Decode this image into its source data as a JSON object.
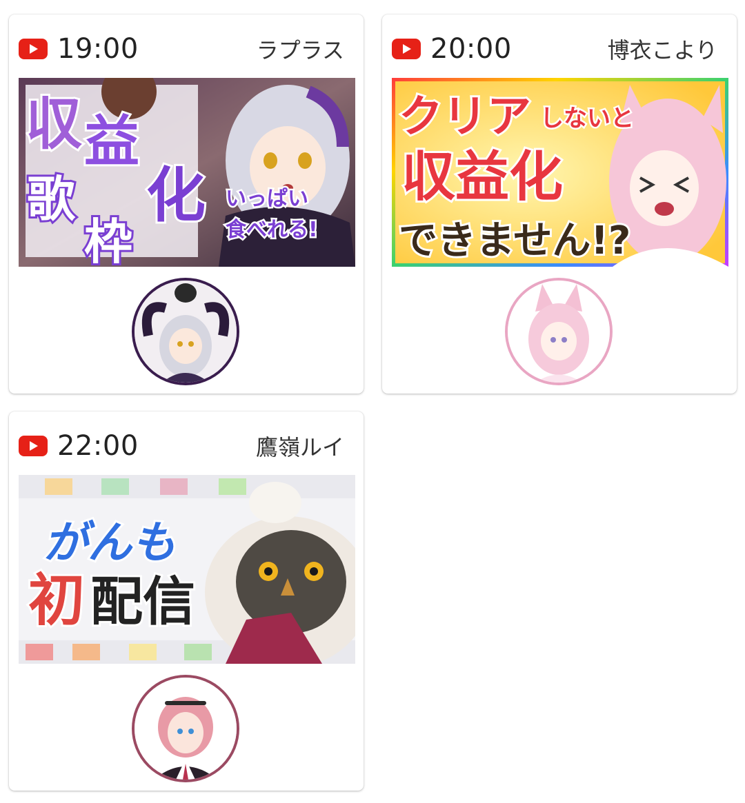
{
  "cards": [
    {
      "time": "19:00",
      "streamer": "ラプラス",
      "thumbnail_lines": [
        "収",
        "益",
        "化",
        "歌",
        "枠",
        "いっぱい",
        "食べれる!"
      ],
      "accent_color": "#3a1d4e"
    },
    {
      "time": "20:00",
      "streamer": "博衣こより",
      "thumbnail_lines": [
        "クリア",
        "しないと",
        "収益化",
        "できません!?"
      ],
      "accent_color": "#e9a6c3"
    },
    {
      "time": "22:00",
      "streamer": "鷹嶺ルイ",
      "thumbnail_lines": [
        "がんも",
        "初",
        "配信"
      ],
      "accent_color": "#9b4a62"
    }
  ],
  "icons": {
    "platform": "youtube-icon"
  },
  "colors": {
    "youtube_red": "#e62117"
  }
}
